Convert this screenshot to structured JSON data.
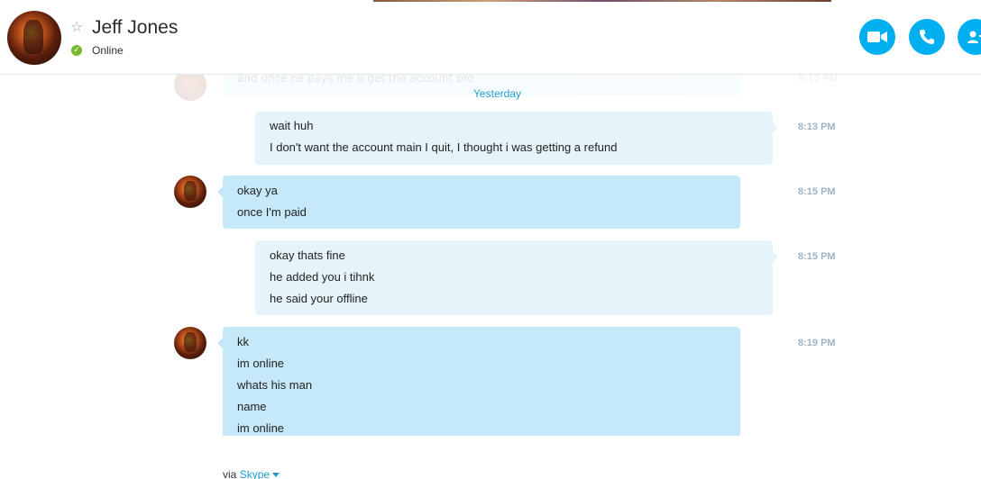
{
  "header": {
    "contact_name": "Jeff Jones",
    "status": "Online",
    "icons": {
      "favorite": "star-icon",
      "status": "online-check-icon",
      "video": "video-camera-icon",
      "audio": "phone-icon",
      "add": "add-person-icon"
    },
    "accent_color": "#00aff0",
    "status_color": "#7cb82f"
  },
  "conversation": {
    "ghost_message": {
      "text": "and once he pays me u get the account bro",
      "time": "8:12 PM"
    },
    "date_separator": "Yesterday",
    "messages": [
      {
        "direction": "out",
        "time": "8:13 PM",
        "lines": [
          "wait huh",
          "I don't want the account main I quit, I thought i was getting a refund"
        ]
      },
      {
        "direction": "in",
        "time": "8:15 PM",
        "lines": [
          "okay ya",
          "once I'm paid"
        ]
      },
      {
        "direction": "out",
        "time": "8:15 PM",
        "lines": [
          "okay thats fine",
          "he added you i tihnk",
          "he said your offline"
        ]
      },
      {
        "direction": "in",
        "time": "8:19 PM",
        "lines": [
          "kk",
          "im online",
          "whats his man",
          "name",
          "im online"
        ]
      }
    ],
    "bubble_colors": {
      "out": "#e5f4fb",
      "in": "#c6e9fa"
    }
  },
  "footer": {
    "via_prefix": "via",
    "via_link": "Skype"
  }
}
